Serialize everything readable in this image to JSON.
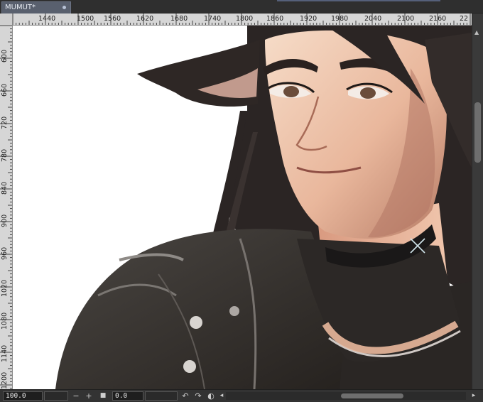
{
  "document": {
    "tab_title": "MUMUT*"
  },
  "rulers": {
    "top_labels": [
      "1440",
      "1500",
      "1560",
      "1620",
      "1680",
      "1740",
      "1800",
      "1860",
      "1920",
      "1980",
      "2040",
      "2100",
      "2160",
      "22"
    ],
    "left_labels": [
      "600",
      "660",
      "720",
      "780",
      "840",
      "900",
      "960",
      "1020",
      "1080",
      "1140",
      "1200"
    ]
  },
  "statusbar": {
    "zoom_value": "100.0",
    "zoom_out_symbol": "−",
    "zoom_in_symbol": "+",
    "fit_symbol": "■",
    "rotation_value": "0.0",
    "rotate_left_symbol": "↶",
    "rotate_right_symbol": "↷",
    "flip_symbol": "◐",
    "scroll_left_symbol": "◂",
    "scroll_right_symbol": "▸"
  },
  "colors": {
    "tab_active": "#59606e",
    "ruler_bg": "#d6d6d6",
    "canvas_bg": "#ffffff",
    "chrome_bg": "#3c3c3c"
  },
  "icons": [
    "tab-modified-dot-icon",
    "scroll-up-icon",
    "rotate-left-icon",
    "rotate-right-icon",
    "flip-icon",
    "scroll-left-icon",
    "scroll-right-icon"
  ]
}
